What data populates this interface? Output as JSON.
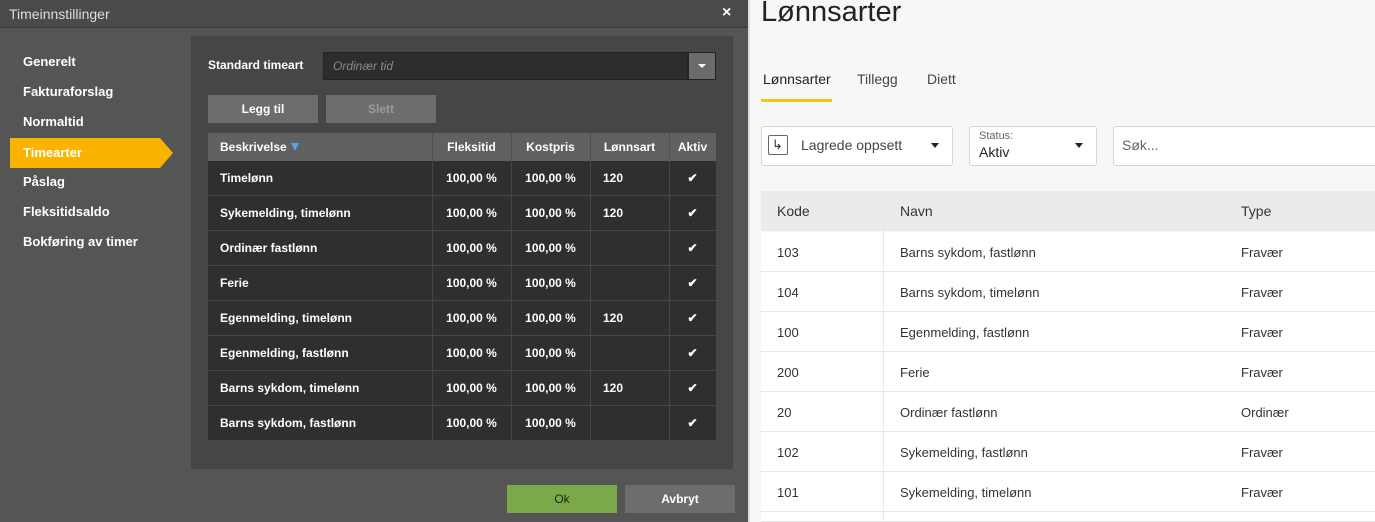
{
  "dialog": {
    "title": "Timeinnstillinger",
    "close_label": "×",
    "nav": [
      "Generelt",
      "Fakturaforslag",
      "Normaltid",
      "Timearter",
      "Påslag",
      "Fleksitidsaldo",
      "Bokføring av timer"
    ],
    "active_nav": "Timearter",
    "standard_timeart_label": "Standard timeart",
    "standard_timeart_placeholder": "Ordinær tid",
    "add_label": "Legg til",
    "delete_label": "Slett",
    "ok_label": "Ok",
    "cancel_label": "Avbryt",
    "table": {
      "headers": [
        "Beskrivelse",
        "Fleksitid",
        "Kostpris",
        "Lønnsart",
        "Aktiv"
      ],
      "rows": [
        {
          "beskrivelse": "Timelønn",
          "fleksitid": "100,00 %",
          "kostpris": "100,00 %",
          "lonnsart": "120",
          "aktiv": "✔"
        },
        {
          "beskrivelse": "Sykemelding, timelønn",
          "fleksitid": "100,00 %",
          "kostpris": "100,00 %",
          "lonnsart": "120",
          "aktiv": "✔"
        },
        {
          "beskrivelse": "Ordinær fastlønn",
          "fleksitid": "100,00 %",
          "kostpris": "100,00 %",
          "lonnsart": "",
          "aktiv": "✔"
        },
        {
          "beskrivelse": "Ferie",
          "fleksitid": "100,00 %",
          "kostpris": "100,00 %",
          "lonnsart": "",
          "aktiv": "✔"
        },
        {
          "beskrivelse": "Egenmelding, timelønn",
          "fleksitid": "100,00 %",
          "kostpris": "100,00 %",
          "lonnsart": "120",
          "aktiv": "✔"
        },
        {
          "beskrivelse": "Egenmelding, fastlønn",
          "fleksitid": "100,00 %",
          "kostpris": "100,00 %",
          "lonnsart": "",
          "aktiv": "✔"
        },
        {
          "beskrivelse": "Barns sykdom, timelønn",
          "fleksitid": "100,00 %",
          "kostpris": "100,00 %",
          "lonnsart": "120",
          "aktiv": "✔"
        },
        {
          "beskrivelse": "Barns sykdom, fastlønn",
          "fleksitid": "100,00 %",
          "kostpris": "100,00 %",
          "lonnsart": "",
          "aktiv": "✔"
        }
      ]
    }
  },
  "lonnsarter": {
    "title": "Lønnsarter",
    "tabs": [
      "Lønnsarter",
      "Tillegg",
      "Diett"
    ],
    "active_tab": "Lønnsarter",
    "saved_setup_label": "Lagrede oppsett",
    "status_label": "Status:",
    "status_value": "Aktiv",
    "search_placeholder": "Søk...",
    "table": {
      "headers": [
        "Kode",
        "Navn",
        "Type"
      ],
      "rows": [
        {
          "kode": "103",
          "navn": "Barns sykdom, fastlønn",
          "type": "Fravær"
        },
        {
          "kode": "104",
          "navn": "Barns sykdom, timelønn",
          "type": "Fravær"
        },
        {
          "kode": "100",
          "navn": "Egenmelding, fastlønn",
          "type": "Fravær"
        },
        {
          "kode": "200",
          "navn": "Ferie",
          "type": "Fravær"
        },
        {
          "kode": "20",
          "navn": "Ordinær fastlønn",
          "type": "Ordinær"
        },
        {
          "kode": "102",
          "navn": "Sykemelding, fastlønn",
          "type": "Fravær"
        },
        {
          "kode": "101",
          "navn": "Sykemelding, timelønn",
          "type": "Fravær"
        }
      ]
    }
  },
  "colors": {
    "accent": "#fab400",
    "ok": "#7ba94a",
    "tab_underline": "#f7c31d",
    "sort_indicator": "#59a4e8"
  }
}
